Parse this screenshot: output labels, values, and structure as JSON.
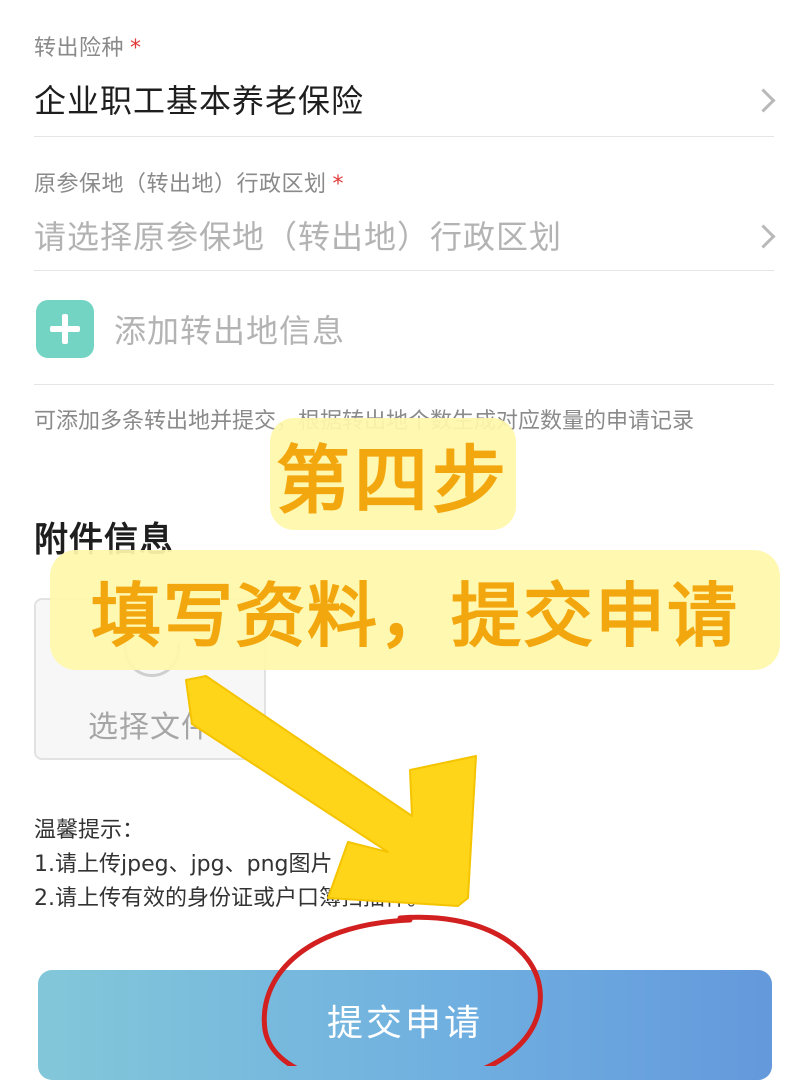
{
  "form": {
    "insurance_type": {
      "label": "转出险种",
      "required_mark": "*",
      "value": "企业职工基本养老保险"
    },
    "origin_region": {
      "label": "原参保地（转出地）行政区划",
      "required_mark": "*",
      "placeholder": "请选择原参保地（转出地）行政区划"
    },
    "add_origin": {
      "label": "添加转出地信息"
    },
    "note": "可添加多条转出地并提交，根据转出地个数生成对应数量的申请记录"
  },
  "attachments": {
    "title": "附件信息",
    "upload_label": "选择文件"
  },
  "tips": {
    "title": "温馨提示：",
    "line1": "1.请上传jpeg、jpg、png图片",
    "line2": "2.请上传有效的身份证或户口簿扫描件。"
  },
  "submit": {
    "label": "提交申请"
  },
  "overlay": {
    "step_title": "第四步",
    "step_desc": "填写资料，提交申请",
    "colors": {
      "banner_bg": "#fff7aa",
      "banner_text": "#f3a70f",
      "arrow": "#ffd51a",
      "circle": "#d1201f"
    }
  },
  "theme": {
    "accent_add": "#74d4c4",
    "required": "#e03a3a",
    "button_gradient": [
      "#82c7d9",
      "#6499dc"
    ]
  }
}
